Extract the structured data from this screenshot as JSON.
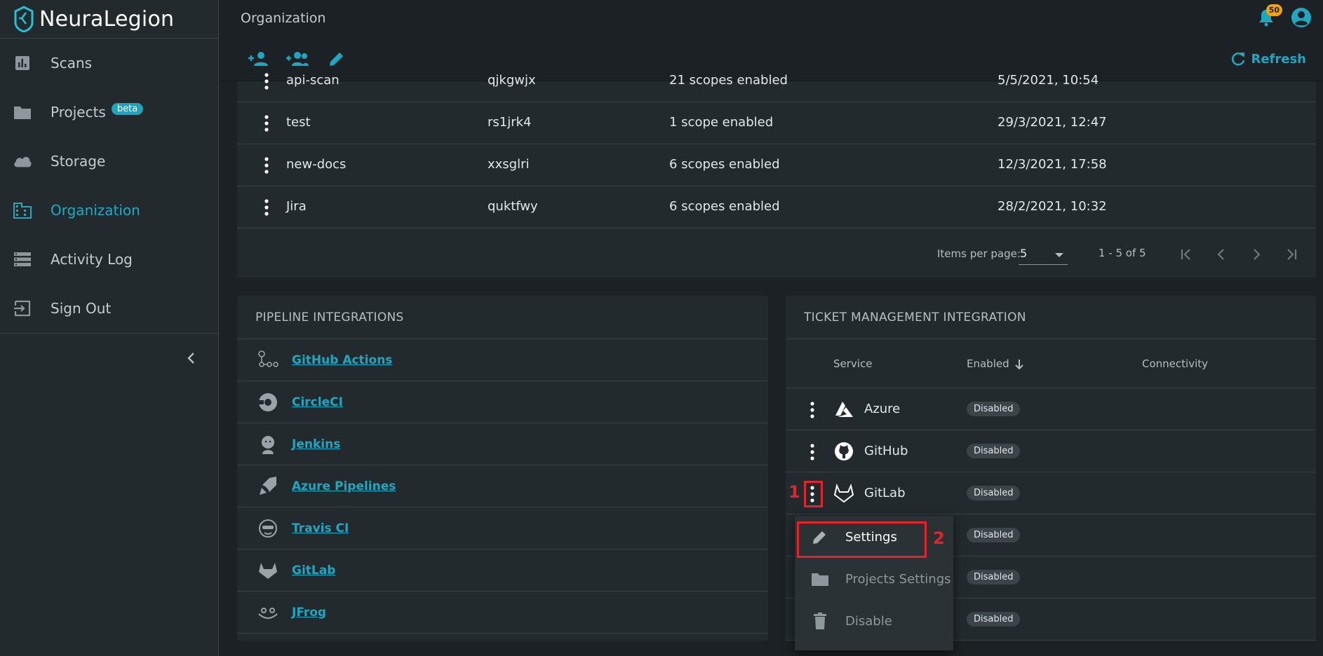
{
  "brand": {
    "name": "NeuraLegion"
  },
  "sidebar": {
    "items": [
      {
        "label": "Scans",
        "icon": "chart-icon"
      },
      {
        "label": "Projects",
        "icon": "folder-icon",
        "badge": "beta"
      },
      {
        "label": "Storage",
        "icon": "cloud-icon"
      },
      {
        "label": "Organization",
        "icon": "organization-icon",
        "active": true
      },
      {
        "label": "Activity Log",
        "icon": "list-icon"
      },
      {
        "label": "Sign Out",
        "icon": "sign-out-icon"
      }
    ]
  },
  "header": {
    "title": "Organization",
    "notifications_count": "50",
    "refresh_label": "Refresh"
  },
  "keys_table": {
    "rows": [
      {
        "name": "api-scan",
        "id": "qjkgwjx",
        "scopes": "21 scopes enabled",
        "date": "5/5/2021, 10:54"
      },
      {
        "name": "test",
        "id": "rs1jrk4",
        "scopes": "1 scope enabled",
        "date": "29/3/2021, 12:47"
      },
      {
        "name": "new-docs",
        "id": "xxsglri",
        "scopes": "6 scopes enabled",
        "date": "12/3/2021, 17:58"
      },
      {
        "name": "Jira",
        "id": "quktfwy",
        "scopes": "6 scopes enabled",
        "date": "28/2/2021, 10:32"
      }
    ],
    "paginator": {
      "items_per_page_label": "Items per page:",
      "items_per_page_value": "5",
      "range": "1 - 5 of 5"
    }
  },
  "pipeline": {
    "title": "PIPELINE INTEGRATIONS",
    "items": [
      {
        "label": "GitHub Actions",
        "icon": "github-actions-icon"
      },
      {
        "label": "CircleCI",
        "icon": "circleci-icon"
      },
      {
        "label": "Jenkins",
        "icon": "jenkins-icon"
      },
      {
        "label": "Azure Pipelines",
        "icon": "azure-pipelines-icon"
      },
      {
        "label": "Travis CI",
        "icon": "travis-ci-icon"
      },
      {
        "label": "GitLab",
        "icon": "gitlab-icon"
      },
      {
        "label": "JFrog",
        "icon": "jfrog-icon"
      }
    ]
  },
  "ticket": {
    "title": "TICKET MANAGEMENT INTEGRATION",
    "columns": {
      "service": "Service",
      "enabled": "Enabled",
      "connectivity": "Connectivity"
    },
    "rows": [
      {
        "service": "Azure",
        "status": "Disabled"
      },
      {
        "service": "GitHub",
        "status": "Disabled"
      },
      {
        "service": "GitLab",
        "status": "Disabled"
      },
      {
        "service": "",
        "status": "Disabled"
      },
      {
        "service": "",
        "status": "Disabled"
      },
      {
        "service": "",
        "status": "Disabled"
      }
    ]
  },
  "menu": {
    "items": [
      {
        "label": "Settings",
        "icon": "pencil-icon"
      },
      {
        "label": "Projects Settings",
        "icon": "folder-icon"
      },
      {
        "label": "Disable",
        "icon": "trash-icon"
      }
    ]
  },
  "annotations": {
    "step1": "1",
    "step2": "2"
  },
  "colors": {
    "accent": "#1fa7c2",
    "background": "#1b2124",
    "panel": "#232a2e",
    "annotation": "#e3242b",
    "badge": "#f2a30f"
  }
}
